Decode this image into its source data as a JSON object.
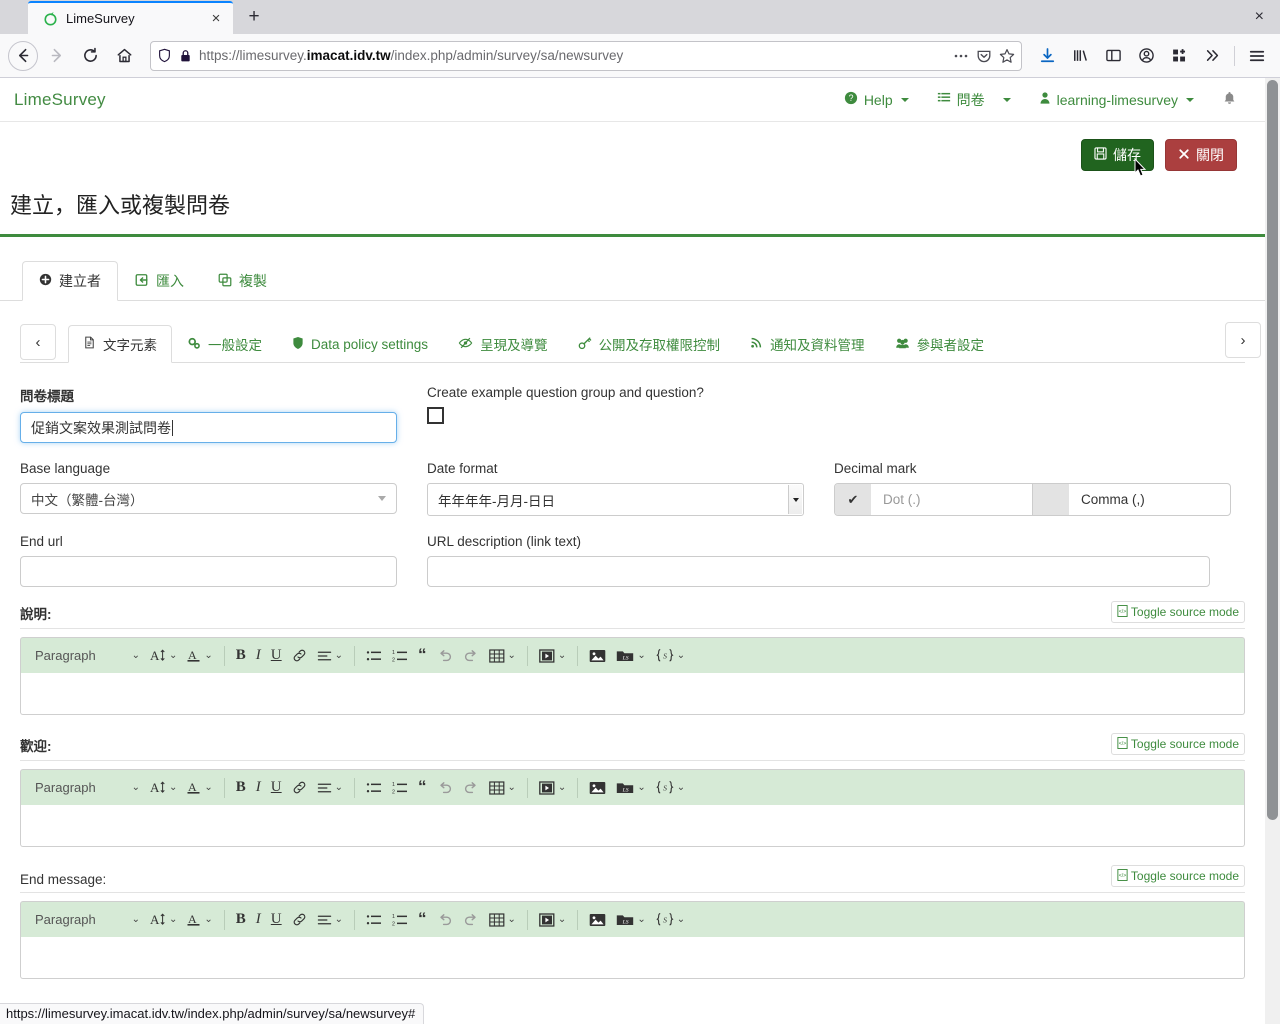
{
  "browser": {
    "tab": {
      "title": "LimeSurvey",
      "favicon": "limesurvey-favicon",
      "close_label": "×"
    },
    "newtab_label": "+",
    "window_close_label": "×",
    "url": {
      "scheme": "https://",
      "prefix": "limesurvey.",
      "host": "imacat.idv.tw",
      "path": "/index.php/admin/survey/sa/newsurvey"
    },
    "url_full": "https://limesurvey.imacat.idv.tw/index.php/admin/survey/sa/newsurvey",
    "toolbar_icons": [
      "download-icon",
      "library-icon",
      "sidebar-icon",
      "account-icon",
      "extensions-icon",
      "overflow-icon",
      "menu-icon"
    ],
    "nav_icons": [
      "back-icon",
      "forward-icon",
      "reload-icon",
      "home-icon"
    ],
    "urlbar_icons": [
      "shield-icon",
      "lock-icon",
      "page-actions-icon",
      "pocket-icon",
      "bookmark-star-icon"
    ]
  },
  "header": {
    "logo": "LimeSurvey",
    "help": "Help",
    "surveys": "問卷",
    "user": "learning-limesurvey",
    "bell": "notification-bell"
  },
  "actions": {
    "save": "儲存",
    "close": "關閉"
  },
  "page": {
    "title": "建立，匯入或複製問卷"
  },
  "primary_tabs": [
    {
      "label": "建立者",
      "icon": "plus-circle-icon",
      "active": true
    },
    {
      "label": "匯入",
      "icon": "import-icon",
      "active": false
    },
    {
      "label": "複製",
      "icon": "copy-icon",
      "active": false
    }
  ],
  "secondary_tabs": [
    {
      "label": "文字元素",
      "icon": "document-icon",
      "active": true
    },
    {
      "label": "一般設定",
      "icon": "gears-icon",
      "active": false
    },
    {
      "label": "Data policy settings",
      "icon": "shield-icon",
      "active": false
    },
    {
      "label": "呈現及導覽",
      "icon": "eye-slash-icon",
      "active": false
    },
    {
      "label": "公開及存取權限控制",
      "icon": "key-icon",
      "active": false
    },
    {
      "label": "通知及資料管理",
      "icon": "rss-icon",
      "active": false
    },
    {
      "label": "參與者設定",
      "icon": "users-icon",
      "active": false
    }
  ],
  "tab_nav": {
    "prev": "‹",
    "next": "›"
  },
  "form": {
    "survey_title": {
      "label": "問卷標題",
      "value": "促銷文案效果測試問卷",
      "focused": true
    },
    "example_question": {
      "label": "Create example question group and question?",
      "checked": false
    },
    "base_language": {
      "label": "Base language",
      "value": "中文（繁體-台灣）"
    },
    "date_format": {
      "label": "Date format",
      "value": "年年年年-月月-日日"
    },
    "decimal_mark": {
      "label": "Decimal mark",
      "options": [
        {
          "label": "Dot (.)",
          "selected": true
        },
        {
          "label": "Comma (,)",
          "selected": false
        }
      ]
    },
    "end_url": {
      "label": "End url",
      "value": ""
    },
    "url_description": {
      "label": "URL description (link text)",
      "value": ""
    }
  },
  "editors": [
    {
      "label": "說明:",
      "source_button": "Toggle source mode",
      "content": "",
      "bold_label": true
    },
    {
      "label": "歡迎:",
      "source_button": "Toggle source mode",
      "content": "",
      "bold_label": true
    },
    {
      "label": "End message:",
      "source_button": "Toggle source mode",
      "content": "",
      "bold_label": false
    }
  ],
  "editor_toolbar": {
    "paragraph": "Paragraph",
    "items": [
      "font-size-icon",
      "font-color-icon",
      "bold-icon",
      "italic-icon",
      "underline-icon",
      "link-icon",
      "align-icon",
      "bulleted-list-icon",
      "numbered-list-icon",
      "blockquote-icon",
      "undo-icon",
      "redo-icon",
      "table-icon",
      "media-icon",
      "image-icon",
      "ls-file-icon",
      "ls-expression-icon"
    ]
  },
  "statusbar": {
    "text": "https://limesurvey.imacat.idv.tw/index.php/admin/survey/sa/newsurvey#"
  },
  "colors": {
    "brand_green": "#3e8b3e",
    "save_green": "#21641f",
    "close_red": "#ab3f3f",
    "toolbar_green": "#d6ead6",
    "focus_blue": "#66afe9"
  }
}
